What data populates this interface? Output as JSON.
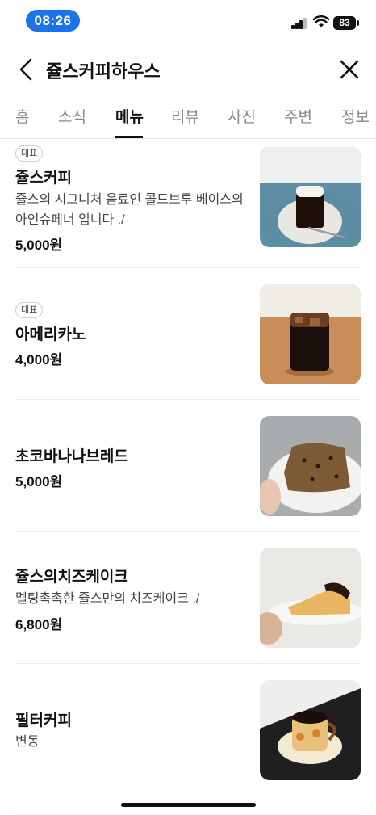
{
  "status_bar": {
    "time": "08:26",
    "battery": "83"
  },
  "header": {
    "title": "쥴스커피하우스"
  },
  "tabs": [
    {
      "label": "홈"
    },
    {
      "label": "소식"
    },
    {
      "label": "메뉴"
    },
    {
      "label": "리뷰"
    },
    {
      "label": "사진"
    },
    {
      "label": "주변"
    },
    {
      "label": "정보"
    }
  ],
  "active_tab": "메뉴",
  "menu_items": [
    {
      "badge": "대표",
      "name": "쥴스커피",
      "description": "쥴스의 시그니처 음료인 콜드브루 베이스의 아인슈페너 입니다 ./",
      "price": "5,000원",
      "image": "coffee-cream-photo"
    },
    {
      "badge": "대표",
      "name": "아메리카노",
      "price": "4,000원",
      "image": "iced-americano-photo"
    },
    {
      "name": "초코바나나브레드",
      "price": "5,000원",
      "image": "banana-bread-photo"
    },
    {
      "name": "쥴스의치즈케이크",
      "description": "멜팅촉촉한 쥴스만의 치즈케이크 ./",
      "price": "6,800원",
      "image": "cheesecake-photo"
    },
    {
      "name": "필터커피",
      "description": "변동",
      "image": "filter-coffee-photo"
    }
  ],
  "colors": {
    "time_pill": "#1a73e8",
    "text": "#111111",
    "muted": "#8a8a8a"
  }
}
